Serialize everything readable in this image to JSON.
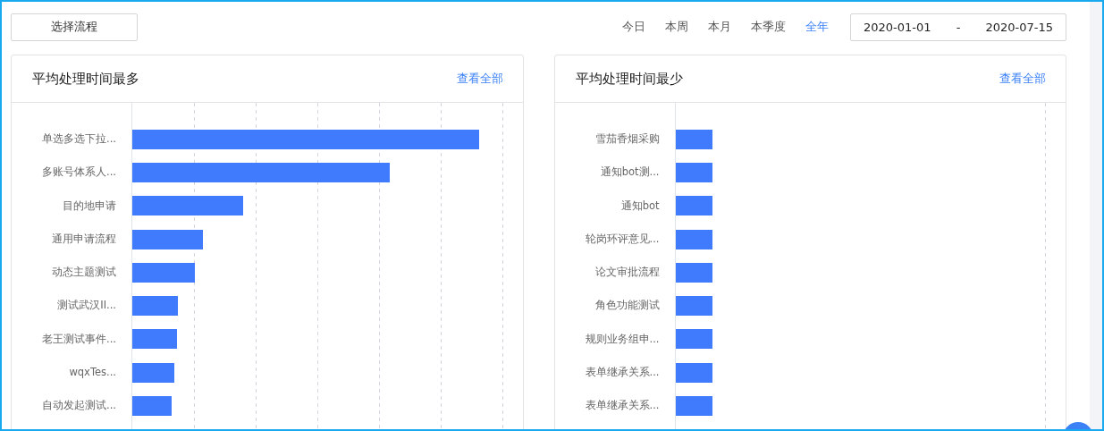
{
  "toolbar": {
    "select_process_button": "选择流程",
    "periods": [
      {
        "label": "今日",
        "selected": false
      },
      {
        "label": "本周",
        "selected": false
      },
      {
        "label": "本月",
        "selected": false
      },
      {
        "label": "本季度",
        "selected": false
      },
      {
        "label": "全年",
        "selected": true
      }
    ],
    "date_range": {
      "start": "2020-01-01",
      "separator": "-",
      "end": "2020-07-15"
    }
  },
  "panels": [
    {
      "title": "平均处理时间最多",
      "link": "查看全部",
      "bars": [
        {
          "label": "单选多选下拉...",
          "level": 0.935
        },
        {
          "label": "多账号体系人...",
          "level": 0.696
        },
        {
          "label": "目的地申请",
          "level": 0.3
        },
        {
          "label": "通用申请流程",
          "level": 0.191
        },
        {
          "label": "动态主题测试",
          "level": 0.17
        },
        {
          "label": "测试武汉II...",
          "level": 0.122
        },
        {
          "label": "老王测试事件...",
          "level": 0.12
        },
        {
          "label": "wqxTes...",
          "level": 0.113
        },
        {
          "label": "自动发起测试...",
          "level": 0.106
        }
      ]
    },
    {
      "title": "平均处理时间最少",
      "link": "查看全部",
      "bars": [
        {
          "label": "雪茄香烟采购",
          "level": 0.099
        },
        {
          "label": "通知bot测...",
          "level": 0.099
        },
        {
          "label": "通知bot",
          "level": 0.099
        },
        {
          "label": "轮岗环评意见...",
          "level": 0.099
        },
        {
          "label": "论文审批流程",
          "level": 0.099
        },
        {
          "label": "角色功能测试",
          "level": 0.099
        },
        {
          "label": "规则业务组申...",
          "level": 0.099
        },
        {
          "label": "表单继承关系...",
          "level": 0.099
        },
        {
          "label": "表单继承关系...",
          "level": 0.099
        }
      ]
    }
  ]
}
